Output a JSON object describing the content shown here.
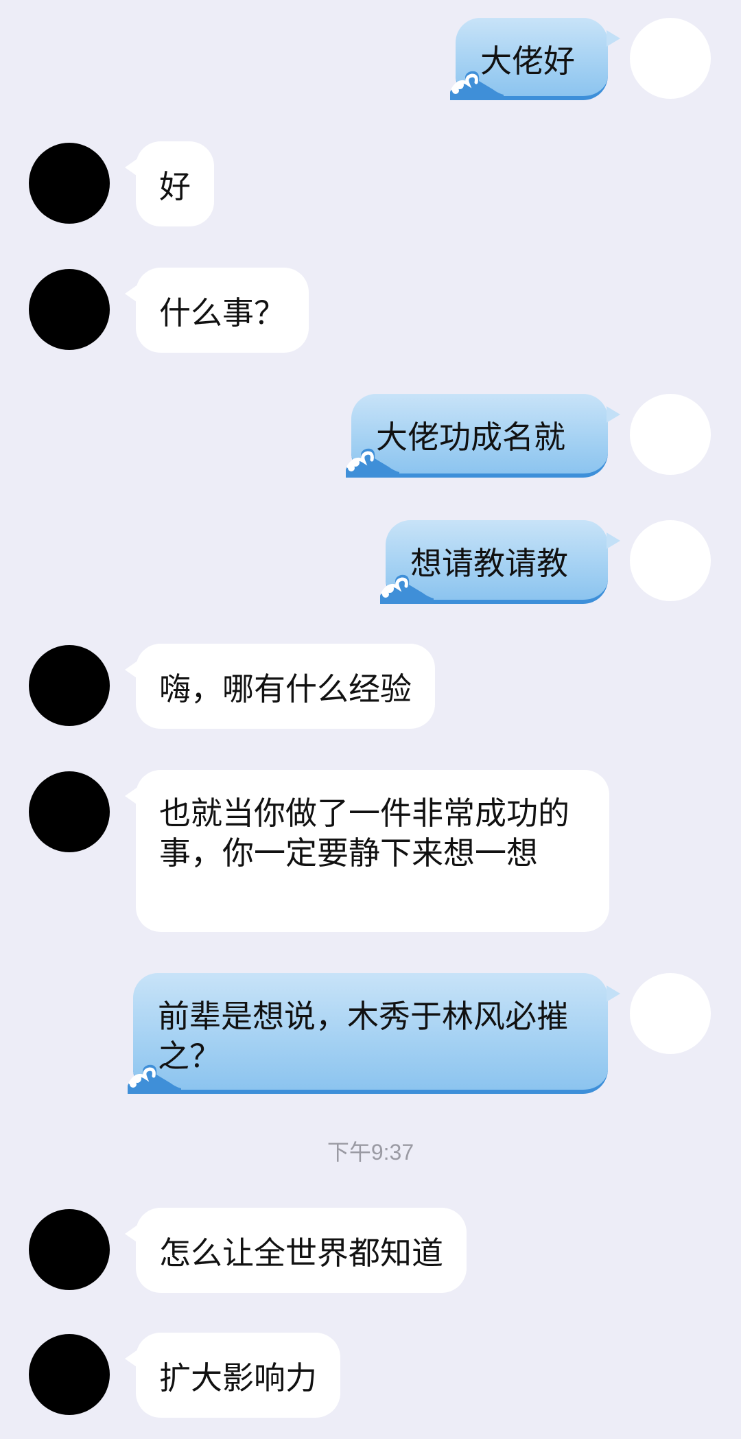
{
  "messages": [
    {
      "side": "out",
      "text": "大佬好"
    },
    {
      "side": "in",
      "text": "好"
    },
    {
      "side": "in",
      "text": "什么事？"
    },
    {
      "side": "out",
      "text": "大佬功成名就"
    },
    {
      "side": "out",
      "text": "想请教请教"
    },
    {
      "side": "in",
      "text": "嗨，哪有什么经验"
    },
    {
      "side": "in",
      "text": "也就当你做了一件非常成功的事，你一定要静下来想一想"
    },
    {
      "side": "out",
      "text": "前辈是想说，木秀于林风必摧之？"
    },
    {
      "side": "in",
      "text": "怎么让全世界都知道"
    },
    {
      "side": "in",
      "text": "扩大影响力"
    }
  ],
  "timestamp": "下午9:37",
  "colors": {
    "background": "#ededf7",
    "incoming_bubble": "#ffffff",
    "outgoing_bubble": "#a6d2f3",
    "outgoing_border": "#3d8fd9",
    "timestamp_text": "#9a9aa3"
  }
}
